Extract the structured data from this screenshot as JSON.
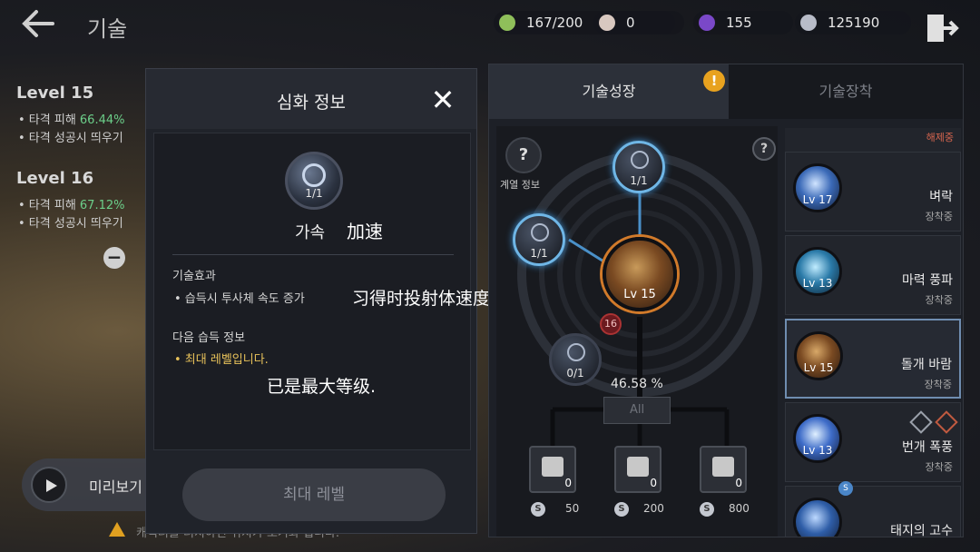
{
  "header": {
    "title": "기술",
    "resources": [
      {
        "icon": "stamina-icon",
        "value": "167/200",
        "color": "#8fbf5a"
      },
      {
        "icon": "pearl-icon",
        "value": "0",
        "color": "#d8c8c0"
      },
      {
        "icon": "gem-icon",
        "value": "155",
        "color": "#7a48c8"
      },
      {
        "icon": "silver-icon",
        "value": "125190",
        "color": "#b8bcc8"
      }
    ]
  },
  "levels": [
    {
      "title": "Level 15",
      "line1_prefix": "• 타격 피해 ",
      "line1_value": "66.44%",
      "line2": "• 타격 성공시 띄우기"
    },
    {
      "title": "Level 16",
      "line1_prefix": "• 타격 피해 ",
      "line1_value": "67.12%",
      "line2": "• 타격 성공시 띄우기"
    }
  ],
  "preview": {
    "label": "미리보기"
  },
  "hint": "캐릭터를 터치하면 위치가 초기화 됩니다.",
  "modal": {
    "title": "심화 정보",
    "skill": {
      "count": "1/1",
      "name": "가속",
      "name_cn": "加速"
    },
    "effect_label": "기술효과",
    "effect_text": "• 습득시 투사체 속도 증가",
    "effect_cn": "习得时投射体速度增加",
    "next_label": "다음 습득 정보",
    "next_text": "• 최대 레벨입니다.",
    "next_cn": "已是最大等级.",
    "max_button": "최대 레벨"
  },
  "tabs": {
    "growth": "기술성장",
    "equip": "기술장착"
  },
  "tree": {
    "info_label": "계열 정보",
    "nodes": [
      {
        "count": "1/1"
      },
      {
        "count": "1/1"
      },
      {
        "count": "0/1"
      }
    ],
    "core_level": "Lv 15",
    "badge": "16",
    "percent": "46.58 %",
    "all_button": "All",
    "items": [
      {
        "count": "0",
        "cost": "50"
      },
      {
        "count": "0",
        "cost": "200"
      },
      {
        "count": "0",
        "cost": "800"
      }
    ]
  },
  "skills": {
    "unequip_label": "해제중",
    "cards": [
      {
        "level": "Lv 17",
        "name": "벼락",
        "status": "장착중"
      },
      {
        "level": "Lv 13",
        "name": "마력 풍파",
        "status": "장착중"
      },
      {
        "level": "Lv 15",
        "name": "돌개 바람",
        "status": "장착중"
      },
      {
        "level": "Lv 13",
        "name": "번개 폭풍",
        "status": "장착중"
      },
      {
        "level": "",
        "name": "태지의 고수",
        "status": ""
      }
    ]
  }
}
